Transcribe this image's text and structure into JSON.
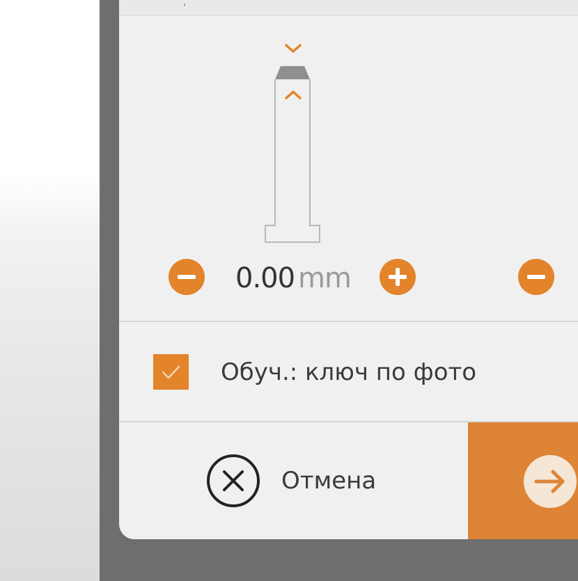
{
  "colors": {
    "accent": "#e3832a",
    "next_button": "#dd8436",
    "dialog_bg": "#f0f0f0",
    "frame": "#6e6e6e"
  },
  "top_strip": {
    "partial_text": ","
  },
  "key_adjust": {
    "value": "0.00",
    "unit": "mm",
    "decrease_icon": "minus-circle-icon",
    "increase_icon": "plus-circle-icon",
    "up_icon": "chevron-up-icon",
    "down_icon": "chevron-down-icon"
  },
  "learn_option": {
    "checked": true,
    "label": "Обуч.: ключ по фото"
  },
  "footer": {
    "cancel_label": "Отмена",
    "cancel_icon": "close-circle-icon",
    "next_icon": "arrow-right-icon"
  }
}
